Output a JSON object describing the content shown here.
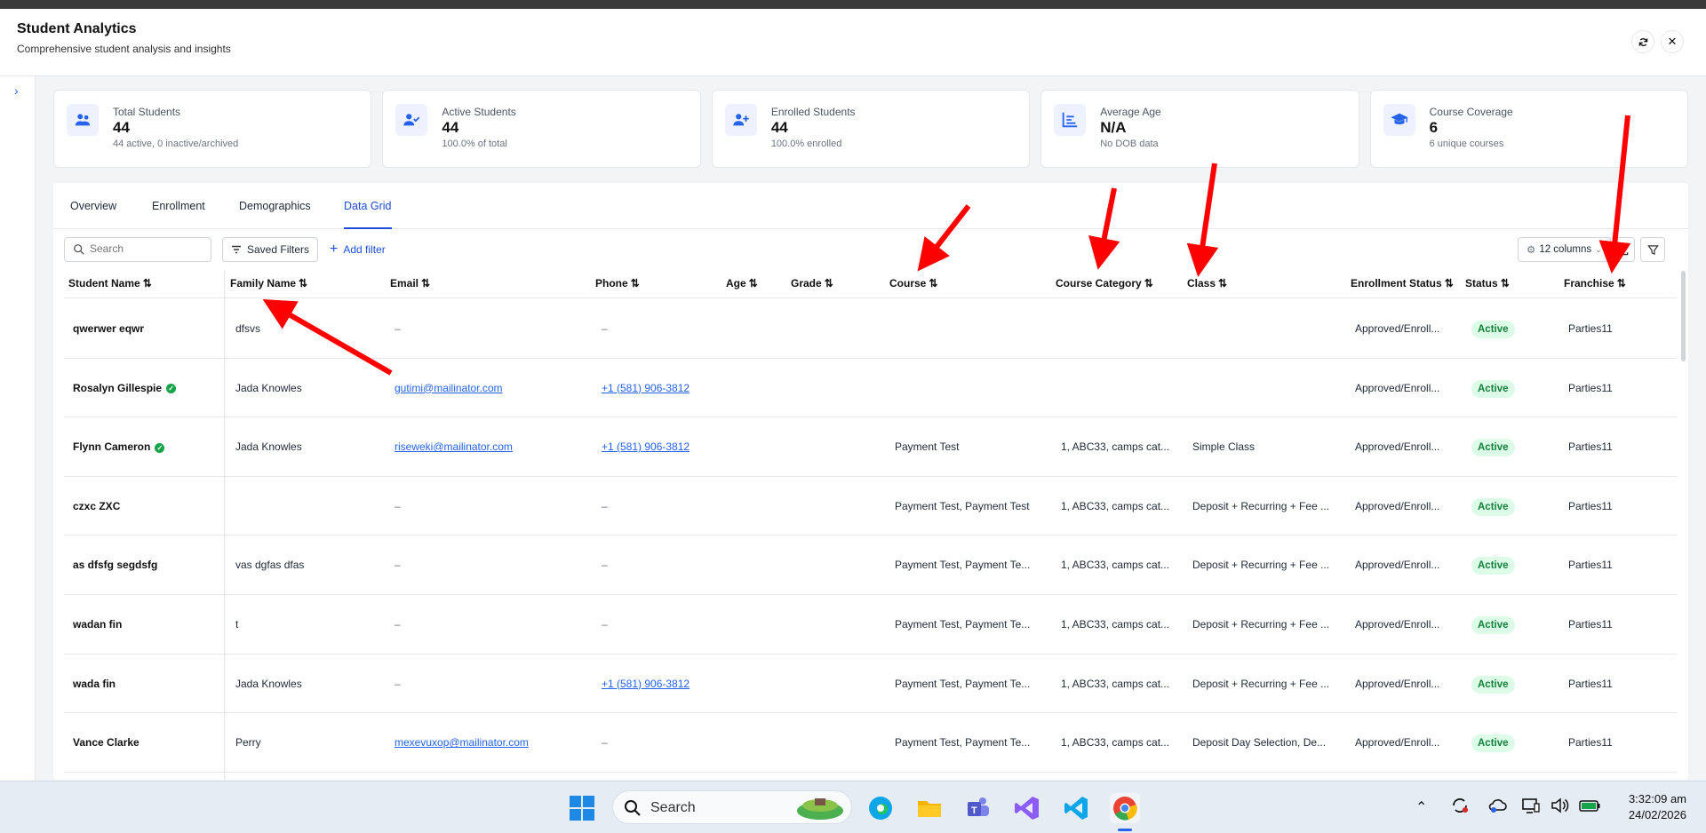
{
  "header": {
    "title": "Student Analytics",
    "subtitle": "Comprehensive student analysis and insights"
  },
  "cards": [
    {
      "label": "Total Students",
      "value": "44",
      "note": "44 active, 0 inactive/archived",
      "icon": "users-icon"
    },
    {
      "label": "Active Students",
      "value": "44",
      "note": "100.0% of total",
      "icon": "user-check-icon"
    },
    {
      "label": "Enrolled Students",
      "value": "44",
      "note": "100.0% enrolled",
      "icon": "user-plus-icon"
    },
    {
      "label": "Average Age",
      "value": "N/A",
      "note": "No DOB data",
      "icon": "chart-icon"
    },
    {
      "label": "Course Coverage",
      "value": "6",
      "note": "6 unique courses",
      "icon": "graduation-cap-icon"
    }
  ],
  "tabs": [
    "Overview",
    "Enrollment",
    "Demographics",
    "Data Grid"
  ],
  "toolbar": {
    "search_placeholder": "Search",
    "saved_filters": "Saved Filters",
    "add_filter": "Add filter",
    "columns": "12 columns"
  },
  "columns": [
    "Student Name",
    "Family Name",
    "Email",
    "Phone",
    "Age",
    "Grade",
    "Course",
    "Course Category",
    "Class",
    "Enrollment Status",
    "Status",
    "Franchise"
  ],
  "rows": [
    {
      "name": "qwerwer eqwr",
      "verified": false,
      "family": "dfsvs",
      "email": "–",
      "phone": "–",
      "course": "",
      "category": "",
      "class": "",
      "enrollment": "Approved/Enroll...",
      "status": "Active",
      "franchise": "Parties11"
    },
    {
      "name": "Rosalyn Gillespie",
      "verified": true,
      "family": "Jada Knowles",
      "email": "gutimi@mailinator.com",
      "phone": "+1 (581) 906-3812",
      "course": "",
      "category": "",
      "class": "",
      "enrollment": "Approved/Enroll...",
      "status": "Active",
      "franchise": "Parties11"
    },
    {
      "name": "Flynn Cameron",
      "verified": true,
      "family": "Jada Knowles",
      "email": "riseweki@mailinator.com",
      "phone": "+1 (581) 906-3812",
      "course": "Payment Test",
      "category": "1, ABC33, camps cat...",
      "class": "Simple Class",
      "enrollment": "Approved/Enroll...",
      "status": "Active",
      "franchise": "Parties11"
    },
    {
      "name": "czxc ZXC",
      "verified": false,
      "family": "",
      "email": "–",
      "phone": "–",
      "course": "Payment Test, Payment Test",
      "category": "1, ABC33, camps cat...",
      "class": "Deposit + Recurring + Fee ...",
      "enrollment": "Approved/Enroll...",
      "status": "Active",
      "franchise": "Parties11"
    },
    {
      "name": "as dfsfg segdsfg",
      "verified": false,
      "family": "vas dgfas dfas",
      "email": "–",
      "phone": "–",
      "course": "Payment Test, Payment Te...",
      "category": "1, ABC33, camps cat...",
      "class": "Deposit + Recurring + Fee ...",
      "enrollment": "Approved/Enroll...",
      "status": "Active",
      "franchise": "Parties11"
    },
    {
      "name": "wadan fin",
      "verified": false,
      "family": "t",
      "email": "–",
      "phone": "–",
      "course": "Payment Test, Payment Te...",
      "category": "1, ABC33, camps cat...",
      "class": "Deposit + Recurring + Fee ...",
      "enrollment": "Approved/Enroll...",
      "status": "Active",
      "franchise": "Parties11"
    },
    {
      "name": "wada fin",
      "verified": false,
      "family": "Jada Knowles",
      "email": "–",
      "phone": "+1 (581) 906-3812",
      "course": "Payment Test, Payment Te...",
      "category": "1, ABC33, camps cat...",
      "class": "Deposit + Recurring + Fee ...",
      "enrollment": "Approved/Enroll...",
      "status": "Active",
      "franchise": "Parties11"
    },
    {
      "name": "Vance Clarke",
      "verified": false,
      "family": "Perry",
      "email": "mexevuxop@mailinator.com",
      "phone": "–",
      "course": "Payment Test, Payment Te...",
      "category": "1, ABC33, camps cat...",
      "class": "Deposit Day Selection, De...",
      "enrollment": "Approved/Enroll...",
      "status": "Active",
      "franchise": "Parties11"
    }
  ],
  "taskbar": {
    "search": "Search",
    "time": "3:32:09 am",
    "date": "24/02/2026"
  },
  "colors": {
    "accent": "#1d4ed8",
    "active_badge_bg": "#dcfce7",
    "active_badge_text": "#15803d",
    "annotation_arrow": "#ff0000"
  }
}
